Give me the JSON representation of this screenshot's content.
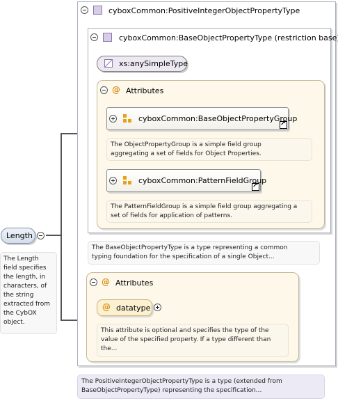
{
  "root": {
    "title": "cyboxCommon:PositiveIntegerObjectPropertyType",
    "doc": "The PositiveIntegerObjectPropertyType is a type (extended from BaseObjectPropertyType) representing the specification..."
  },
  "base": {
    "title": "cyboxCommon:BaseObjectPropertyType (restriction base)",
    "simple_type": "xs:anySimpleType",
    "attributes_label": "Attributes",
    "groups": [
      {
        "name": "cyboxCommon:BaseObjectPropertyGroup",
        "doc_line1": "The ObjectPropertyGroup is a simple field group",
        "doc_line2": "aggregating a set of fields for Object Properties."
      },
      {
        "name": "cyboxCommon:PatternFieldGroup",
        "doc_line1": "The PatternFieldGroup is a simple field group aggregating a",
        "doc_line2": "set of fields for application of patterns."
      }
    ],
    "doc_line1": "The BaseObjectPropertyType is a type representing a common",
    "doc_line2": "typing foundation for the specification of a single Object..."
  },
  "ext_attributes": {
    "label": "Attributes",
    "attr_name": "datatype",
    "doc_line1": "This attribute is optional and specifies the type of the",
    "doc_line2": "value of the specified property. If a type different than",
    "doc_line3": "the..."
  },
  "element": {
    "name": "Length",
    "doc_lines": [
      "The Length",
      "field specifies",
      "the length, in",
      "characters, of",
      "the string",
      "extracted from",
      "the CybOX",
      "object."
    ]
  },
  "root_doc_line1": "The PositiveIntegerObjectPropertyType is a type (extended from",
  "root_doc_line2": "BaseObjectPropertyType) representing the specification..."
}
